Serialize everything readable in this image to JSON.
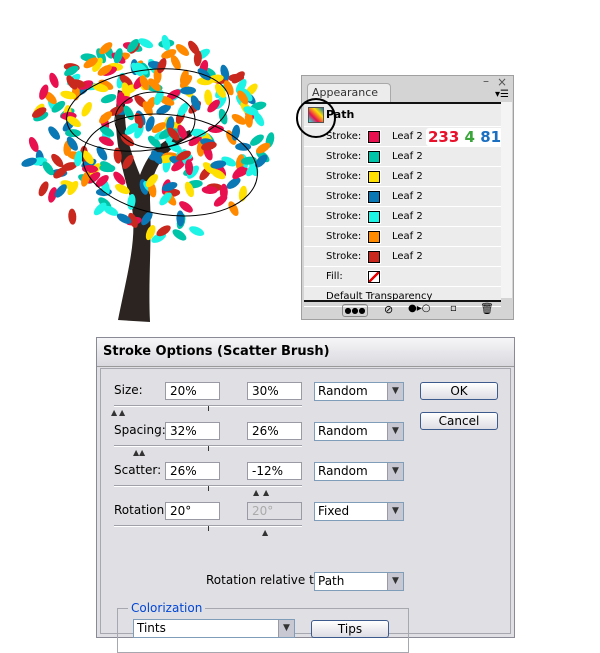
{
  "appearance": {
    "tab_label": "Appearance",
    "close_glyph": "×",
    "item_label": "Path",
    "strokes": [
      {
        "label": "Stroke:",
        "color": "#e8104f",
        "brush": "Leaf 2"
      },
      {
        "label": "Stroke:",
        "color": "#00c4a8",
        "brush": "Leaf 2"
      },
      {
        "label": "Stroke:",
        "color": "#ffe000",
        "brush": "Leaf 2"
      },
      {
        "label": "Stroke:",
        "color": "#0a78b4",
        "brush": "Leaf 2"
      },
      {
        "label": "Stroke:",
        "color": "#1ef4e6",
        "brush": "Leaf 2"
      },
      {
        "label": "Stroke:",
        "color": "#ff8a00",
        "brush": "Leaf 2"
      },
      {
        "label": "Stroke:",
        "color": "#c8281e",
        "brush": "Leaf 2"
      }
    ],
    "rgb_annotation": {
      "r": "233",
      "g": "4",
      "b": "81",
      "r_color": "#e8102a",
      "g_color": "#3aa63a",
      "b_color": "#1a6fc0"
    },
    "fill_label": "Fill:",
    "transparency_label": "Default Transparency"
  },
  "dialog": {
    "title": "Stroke Options (Scatter Brush)",
    "rows": [
      {
        "label": "Size:",
        "min": "20%",
        "max": "30%",
        "mode": "Random"
      },
      {
        "label": "Spacing:",
        "min": "32%",
        "max": "26%",
        "mode": "Random"
      },
      {
        "label": "Scatter:",
        "min": "26%",
        "max": "-12%",
        "mode": "Random"
      },
      {
        "label": "Rotation:",
        "min": "20°",
        "max": "20°",
        "mode": "Fixed"
      }
    ],
    "rotation_relative_label": "Rotation relative to:",
    "rotation_relative_value": "Path",
    "colorization_label": "Colorization",
    "colorization_value": "Tints",
    "tips_label": "Tips",
    "ok_label": "OK",
    "cancel_label": "Cancel"
  },
  "leaf_colors": [
    "#e8104f",
    "#00c4a8",
    "#ffe000",
    "#0a78b4",
    "#1ef4e6",
    "#ff8a00",
    "#c8281e"
  ]
}
